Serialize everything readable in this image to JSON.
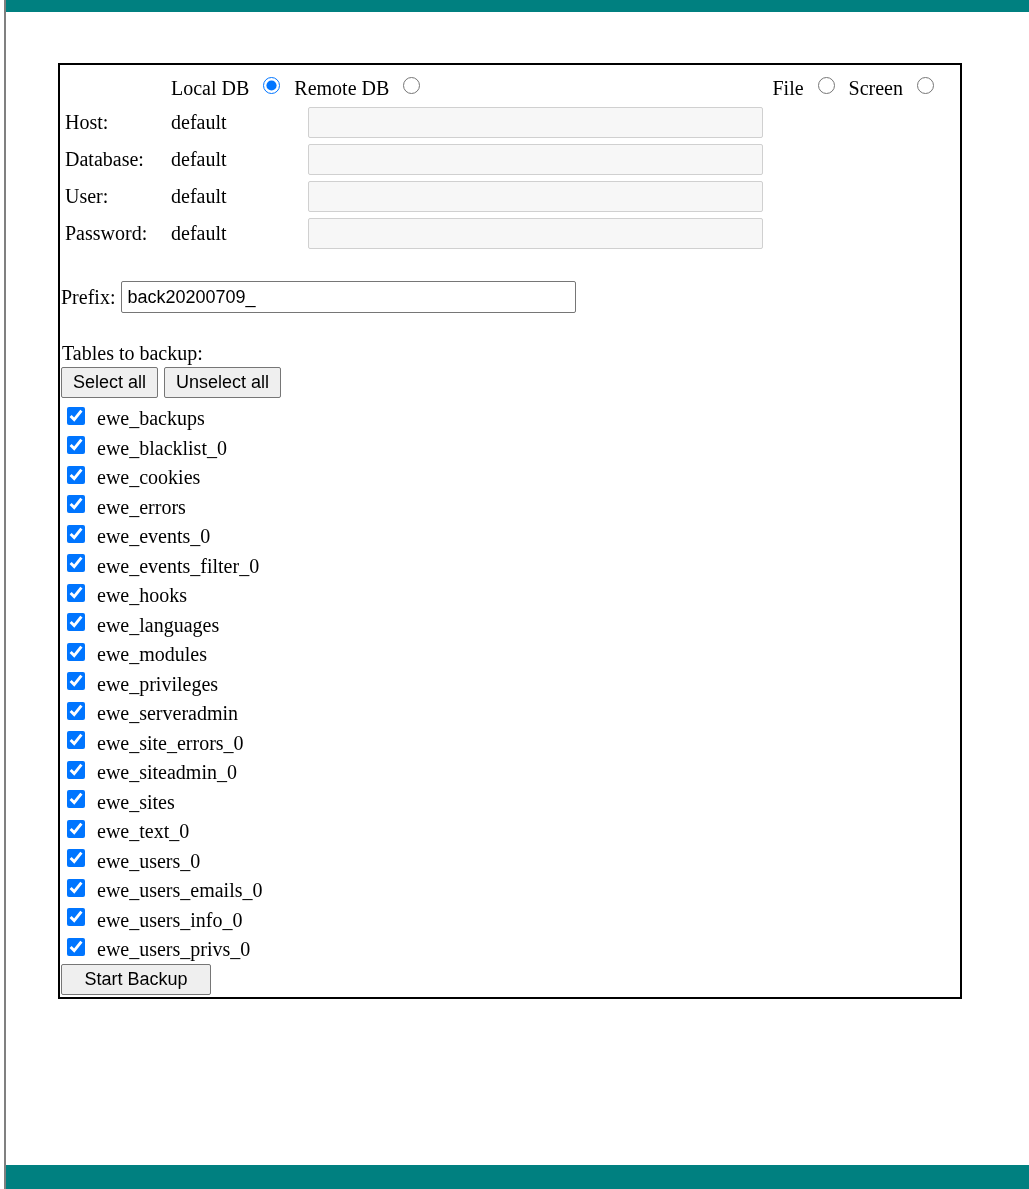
{
  "source_options": [
    {
      "label": "Local DB",
      "selected": true
    },
    {
      "label": "Remote DB",
      "selected": false
    }
  ],
  "output_options": [
    {
      "label": "File",
      "selected": false
    },
    {
      "label": "Screen",
      "selected": false
    }
  ],
  "connection_fields": [
    {
      "label": "Host:",
      "value": "default",
      "disabled": true
    },
    {
      "label": "Database:",
      "value": "default",
      "disabled": true
    },
    {
      "label": "User:",
      "value": "default",
      "disabled": true
    },
    {
      "label": "Password:",
      "value": "default",
      "disabled": true
    }
  ],
  "prefix": {
    "label": "Prefix:",
    "value": "back20200709_"
  },
  "tables_heading": "Tables to backup:",
  "buttons": [
    "Select all",
    "Unselect all"
  ],
  "tables": [
    {
      "name": "ewe_backups",
      "checked": true
    },
    {
      "name": "ewe_blacklist_0",
      "checked": true
    },
    {
      "name": "ewe_cookies",
      "checked": true
    },
    {
      "name": "ewe_errors",
      "checked": true
    },
    {
      "name": "ewe_events_0",
      "checked": true
    },
    {
      "name": "ewe_events_filter_0",
      "checked": true
    },
    {
      "name": "ewe_hooks",
      "checked": true
    },
    {
      "name": "ewe_languages",
      "checked": true
    },
    {
      "name": "ewe_modules",
      "checked": true
    },
    {
      "name": "ewe_privileges",
      "checked": true
    },
    {
      "name": "ewe_serveradmin",
      "checked": true
    },
    {
      "name": "ewe_site_errors_0",
      "checked": true
    },
    {
      "name": "ewe_siteadmin_0",
      "checked": true
    },
    {
      "name": "ewe_sites",
      "checked": true
    },
    {
      "name": "ewe_text_0",
      "checked": true
    },
    {
      "name": "ewe_users_0",
      "checked": true
    },
    {
      "name": "ewe_users_emails_0",
      "checked": true
    },
    {
      "name": "ewe_users_info_0",
      "checked": true
    },
    {
      "name": "ewe_users_privs_0",
      "checked": true
    }
  ],
  "submit_button": "Start Backup"
}
